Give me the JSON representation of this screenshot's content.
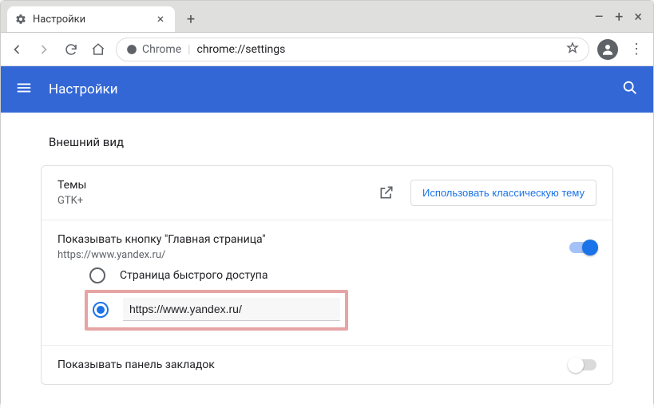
{
  "window": {
    "tab_title": "Настройки",
    "omnibox": {
      "app": "Chrome",
      "url": "chrome://settings"
    }
  },
  "header": {
    "title": "Настройки"
  },
  "appearance": {
    "section_title": "Внешний вид",
    "themes": {
      "label": "Темы",
      "sub": "GTK+",
      "classic_btn": "Использовать классическую тему"
    },
    "home_button": {
      "label": "Показывать кнопку \"Главная страница\"",
      "sub": "https://www.yandex.ru/",
      "toggle": true,
      "option_ntp": "Страница быстрого доступа",
      "option_custom_value": "https://www.yandex.ru/",
      "selected": "custom"
    },
    "bookmarks_bar": {
      "label": "Показывать панель закладок",
      "toggle": false
    }
  }
}
